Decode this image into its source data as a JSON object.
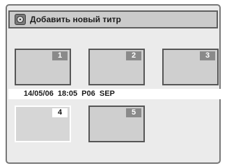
{
  "header": {
    "title": "Добавить новый титр",
    "icon": "disc-icon"
  },
  "thumbnails": [
    {
      "number": "1"
    },
    {
      "number": "2"
    },
    {
      "number": "3"
    },
    {
      "number": "4"
    },
    {
      "number": "5"
    }
  ],
  "selected_thumbnail": "4",
  "info": {
    "text": "14/05/06  18:05  P06  SEP"
  },
  "colors": {
    "panel_bg": "#ebebeb",
    "title_bar_bg": "#cbcbcb",
    "thumb_bg": "#cfcfcf",
    "selected_border": "#ffffff"
  }
}
